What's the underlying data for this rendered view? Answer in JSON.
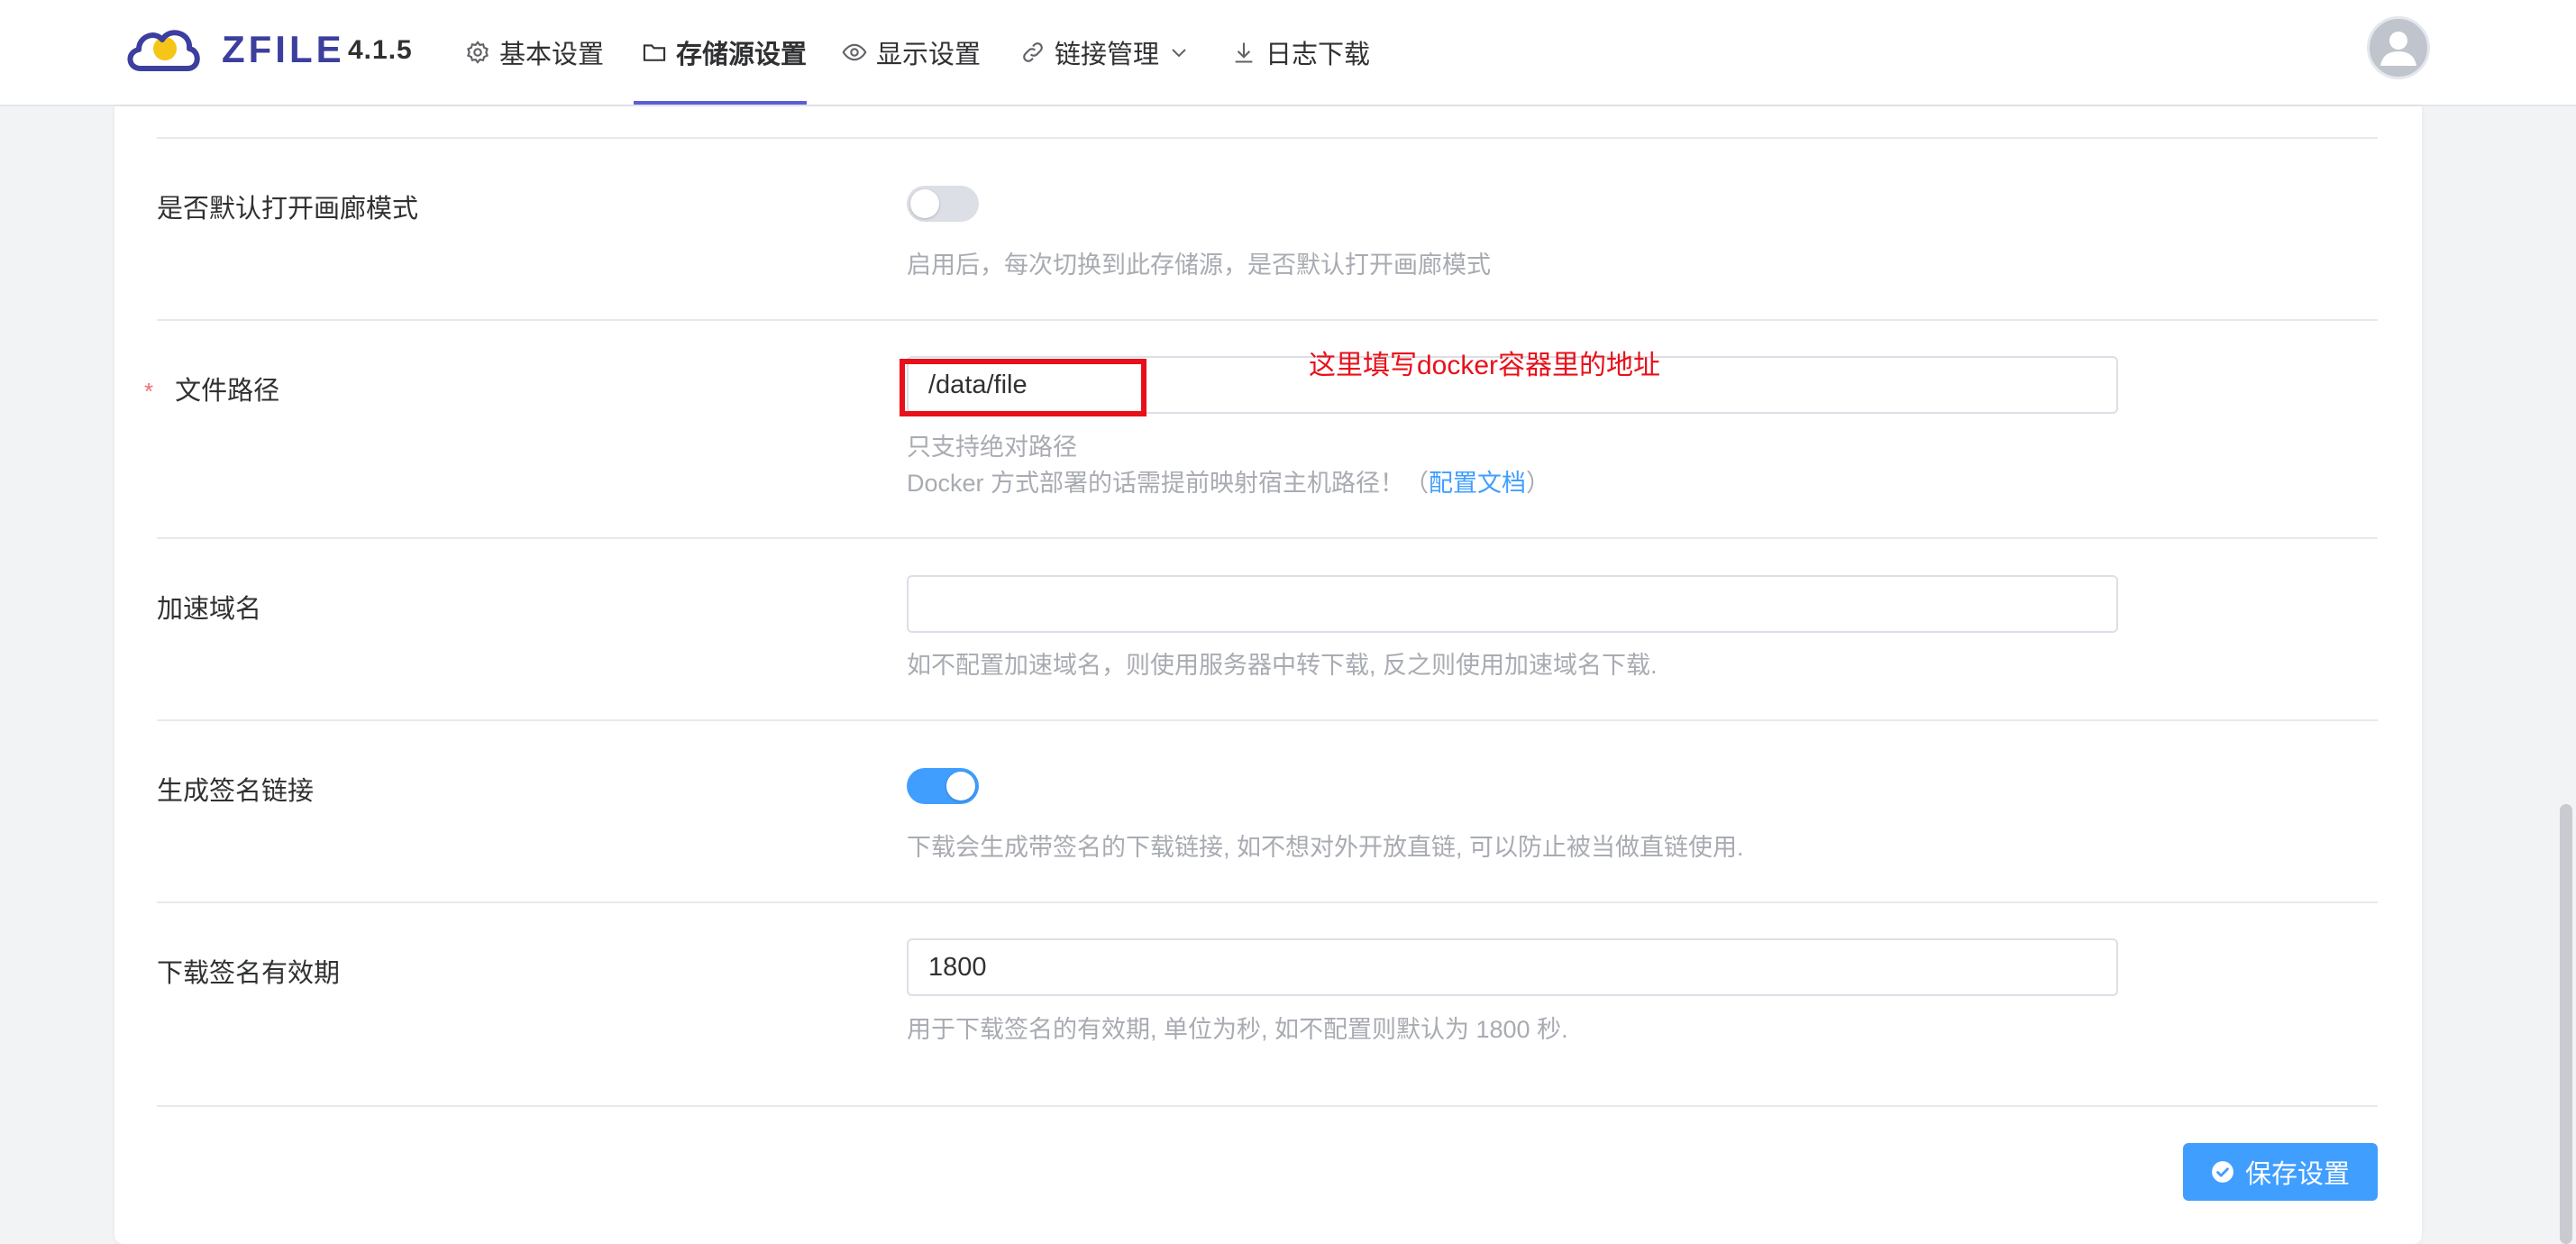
{
  "header": {
    "brand_name": "ZFILE",
    "version": "4.1.5",
    "nav": [
      {
        "label": "基本设置",
        "icon": "gear-icon"
      },
      {
        "label": "存储源设置",
        "icon": "folder-icon",
        "active": true
      },
      {
        "label": "显示设置",
        "icon": "eye-icon"
      },
      {
        "label": "链接管理",
        "icon": "link-icon",
        "has_dropdown": true
      },
      {
        "label": "日志下载",
        "icon": "download-icon"
      }
    ]
  },
  "form": {
    "gallery_mode": {
      "label": "是否默认打开画廊模式",
      "enabled": false,
      "hint": "启用后，每次切换到此存储源，是否默认打开画廊模式"
    },
    "file_path": {
      "label": "文件路径",
      "required_mark": "*",
      "value": "/data/file",
      "hint_line1": "只支持绝对路径",
      "hint_line2_prefix": "Docker 方式部署的话需提前映射宿主机路径！（",
      "hint_link": "配置文档",
      "hint_line2_suffix": "）"
    },
    "accel_domain": {
      "label": "加速域名",
      "value": "",
      "hint": "如不配置加速域名，则使用服务器中转下载, 反之则使用加速域名下载."
    },
    "signed_link": {
      "label": "生成签名链接",
      "enabled": true,
      "hint": "下载会生成带签名的下载链接, 如不想对外开放直链, 可以防止被当做直链使用."
    },
    "sign_expire": {
      "label": "下载签名有效期",
      "value": "1800",
      "hint": "用于下载签名的有效期, 单位为秒, 如不配置则默认为 1800 秒."
    },
    "save_label": "保存设置"
  },
  "annotation": {
    "text": "这里填写docker容器里的地址",
    "color": "#e8101a"
  },
  "colors": {
    "primary": "#409eff",
    "brand": "#3c3f9e",
    "hint": "#a8abb2",
    "required": "#f56c6c"
  }
}
